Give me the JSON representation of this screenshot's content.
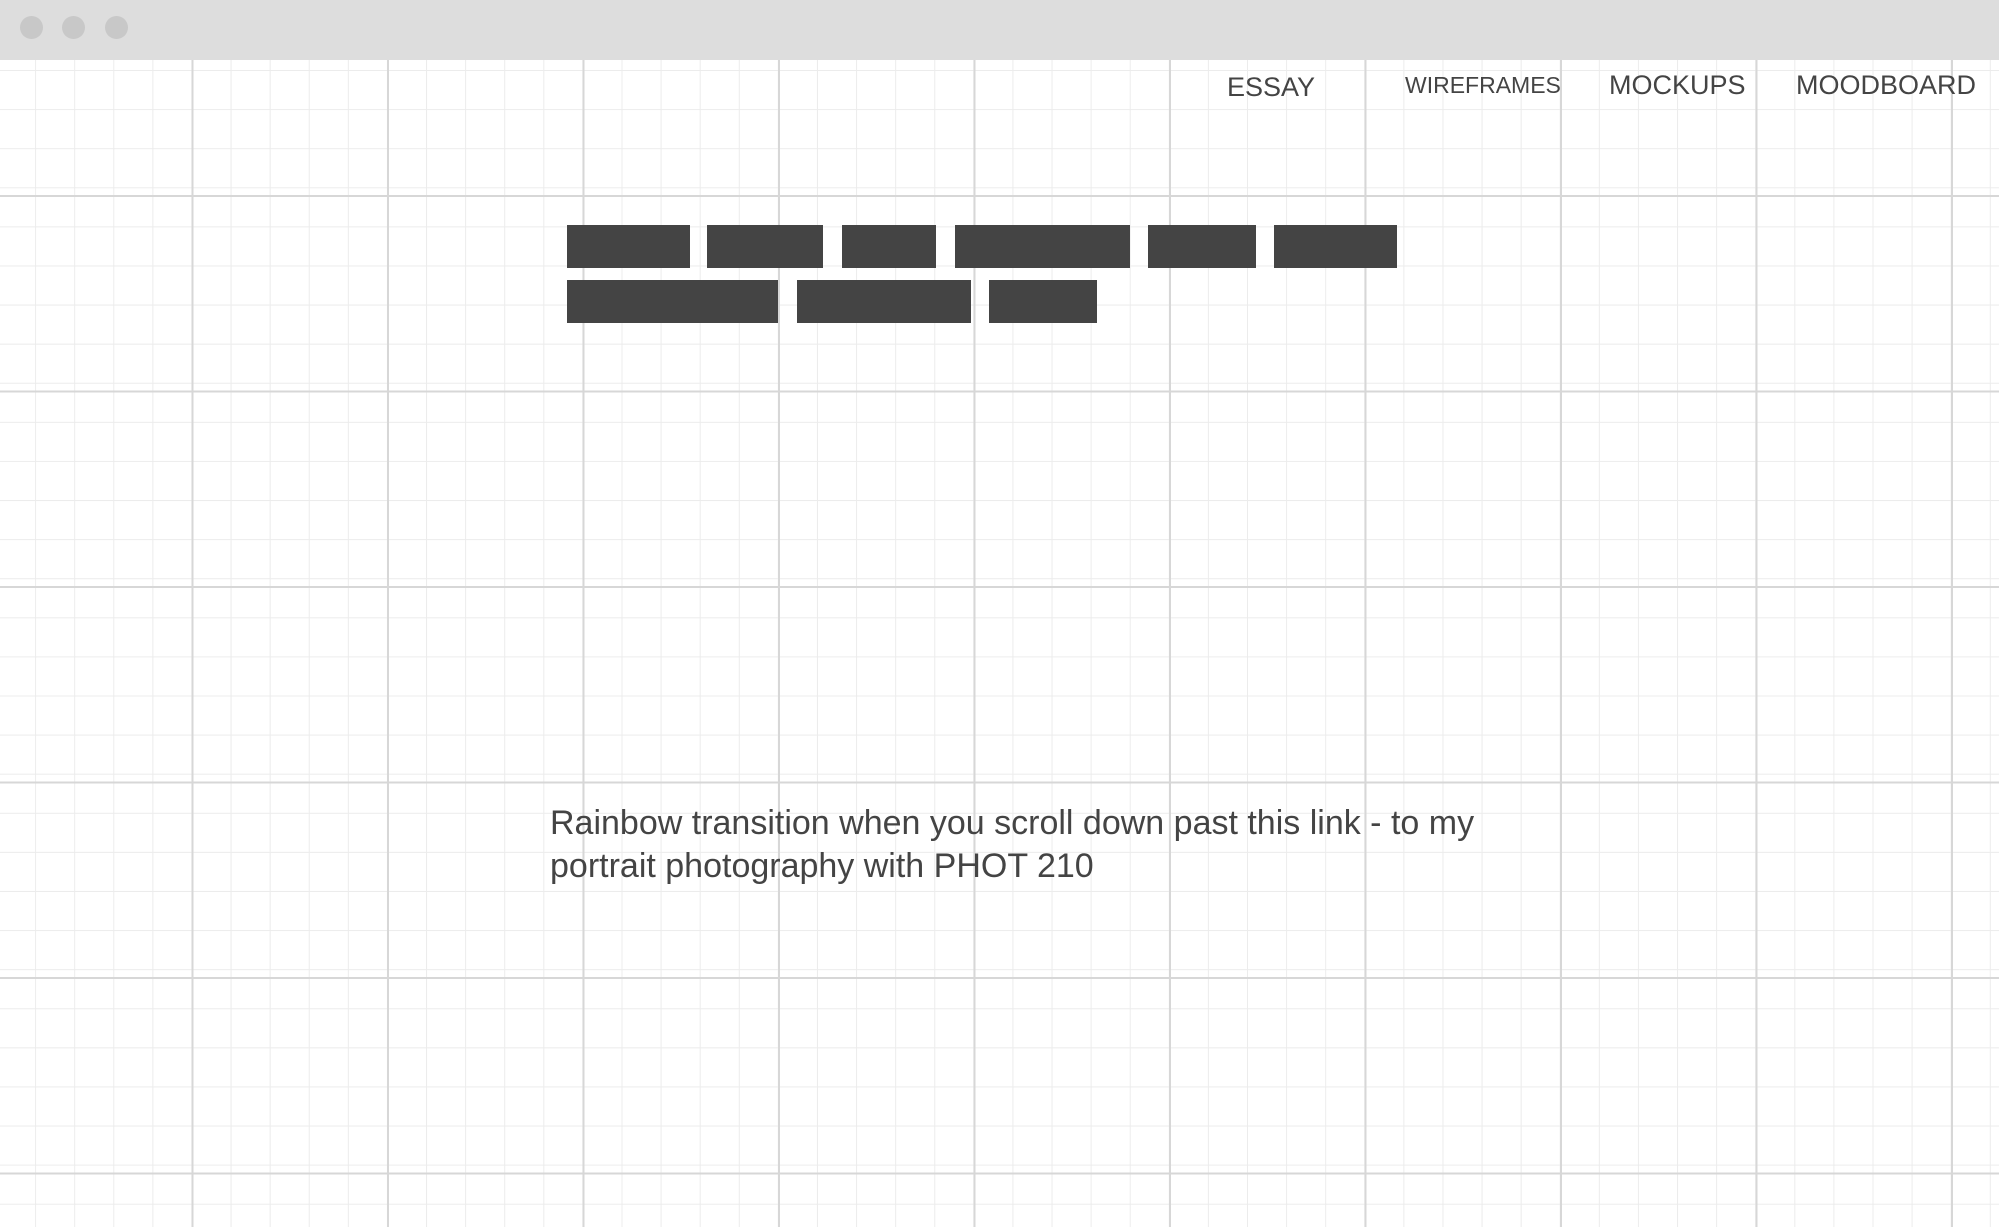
{
  "window": {
    "controls": [
      "close-dot",
      "minimize-dot",
      "maximize-dot"
    ]
  },
  "nav": {
    "essay": "ESSAY",
    "wireframes": "WIREFRAMES",
    "mockups": "MOCKUPS",
    "moodboard": "MOODBOARD"
  },
  "main": {
    "caption": "Rainbow transition when you scroll down past this link - to my portrait photography with PHOT 210"
  },
  "colors": {
    "text": "#444444",
    "placeholder_block": "#444444",
    "titlebar": "#dddddd",
    "grid_major": "#d7d7d7",
    "grid_minor": "#ececec"
  }
}
